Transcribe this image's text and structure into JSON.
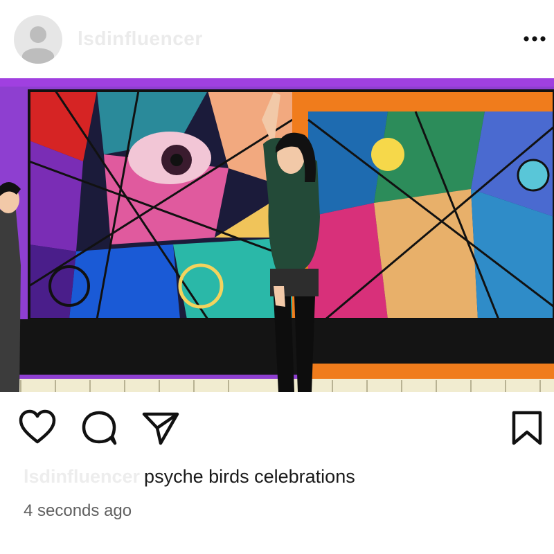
{
  "post": {
    "username": "lsdinfluencer",
    "caption": {
      "username": "lsdinfluencer",
      "text": "psyche birds celebrations"
    },
    "timestamp": "4 seconds ago",
    "icons": {
      "avatar": "default-avatar-icon",
      "more": "more-options-icon",
      "like": "heart-icon",
      "comment": "comment-icon",
      "share": "send-icon",
      "save": "bookmark-icon"
    }
  }
}
